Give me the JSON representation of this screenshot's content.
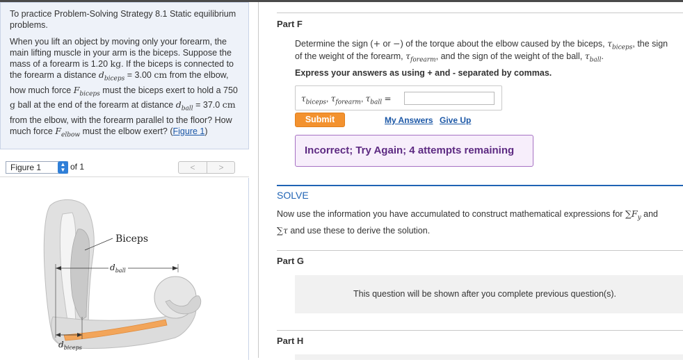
{
  "left": {
    "intro_title": "To practice Problem-Solving Strategy 8.1 Static equilibrium problems.",
    "problem": {
      "t1": "When you lift an object by moving only your forearm, the main lifting muscle in your arm is the biceps. Suppose the mass of a forearm is 1.20",
      "u_kg": "kg",
      "t2": ". If the biceps is connected to the forearm a distance",
      "v_dbiceps": "d",
      "v_dbiceps_sub": "biceps",
      "t3": "= 3.00",
      "u_cm1": "cm",
      "t4": "from the elbow, how much force",
      "v_F": "F",
      "v_F_sub": "biceps",
      "t5": "must the biceps exert to hold a 750",
      "u_g": "g",
      "t6": "ball at the end of the forearm at distance",
      "v_dball": "d",
      "v_dball_sub": "ball",
      "t7": "= 37.0",
      "u_cm2": "cm",
      "t8": "from the elbow, with the forearm parallel to the floor? How much force",
      "v_Felbow": "F",
      "v_Felbow_sub": "elbow",
      "t9": "must the elbow exert? (",
      "fig_link": "Figure 1",
      "t10": ")"
    },
    "figure_bar": {
      "select_value": "Figure 1",
      "of_text": "of 1",
      "prev": "<",
      "next": ">"
    },
    "figure_labels": {
      "biceps": "Biceps",
      "dball_main": "d",
      "dball_sub": "ball",
      "dbiceps_main": "d",
      "dbiceps_sub": "biceps"
    }
  },
  "right": {
    "partF": {
      "title": "Part F",
      "q1a": "Determine the sign (",
      "q1_plus": "+",
      "q1b": "or",
      "q1_minus": "−",
      "q1c": ") of the torque about the elbow caused by the biceps,",
      "tau": "τ",
      "sub_biceps": "biceps",
      "q1d": ", the sign",
      "q2a": "of the weight of the forearm,",
      "sub_forearm": "forearm",
      "q2b": ", and the sign of the weight of the ball,",
      "sub_ball": "ball",
      "q2c": ".",
      "instruction": "Express your answers as using + and - separated by commas.",
      "answer_label_sep": ",",
      "answer_eq": "=",
      "answer_value": "",
      "submit": "Submit",
      "my_answers": "My Answers",
      "give_up": "Give Up",
      "feedback": "Incorrect; Try Again; 4 attempts remaining"
    },
    "solve": {
      "heading": "SOLVE",
      "t1": "Now use the information you have accumulated to construct mathematical expressions for",
      "sum": "∑",
      "F": "F",
      "F_sub": "y",
      "and": "and",
      "t2_sum": "∑",
      "t2_tau": "τ",
      "t2": "and use these to derive the solution."
    },
    "partG": {
      "title": "Part G",
      "locked": "This question will be shown after you complete previous question(s)."
    },
    "partH": {
      "title": "Part H"
    }
  },
  "colors": {
    "submit": "#f3922f",
    "link": "#1b57a6",
    "feedback_text": "#5d2a82",
    "feedback_border": "#a671c3",
    "solve": "#1f63b4",
    "bone": "#f2a55a"
  },
  "icons": [
    "select-updown-icon",
    "prev-arrow-icon",
    "next-arrow-icon"
  ]
}
